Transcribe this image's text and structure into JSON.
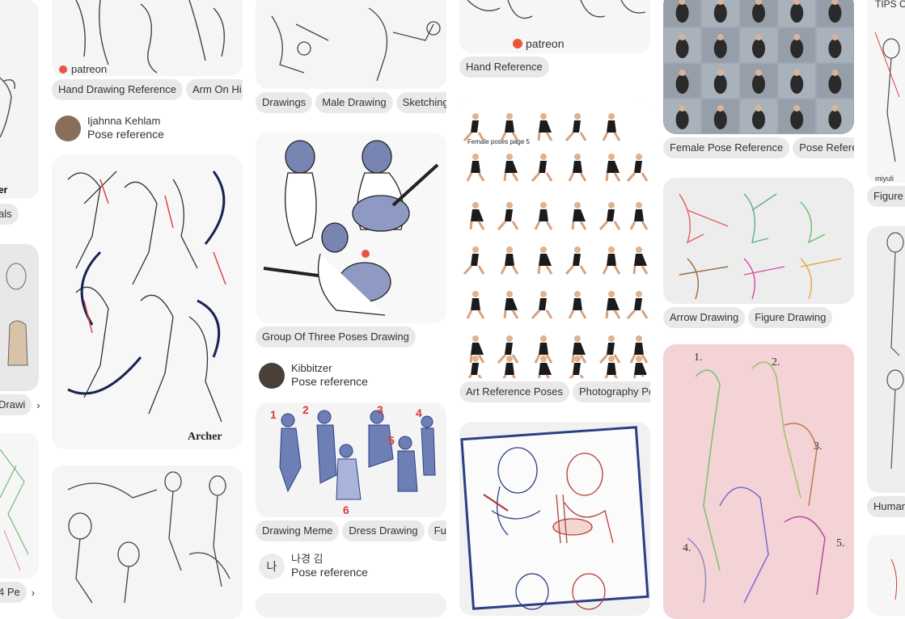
{
  "col0": {
    "chip_a": "als",
    "chip_b": "Drawi",
    "chip_c": "4 Pe",
    "partial_text": "er"
  },
  "col1": {
    "card1_chips": [
      "Hand Drawing Reference",
      "Arm On Hi"
    ],
    "card1_author": "Ijahnna Kehlam",
    "card1_board": "Pose reference",
    "card2_caption": "Archer"
  },
  "col2": {
    "card1_chips": [
      "Drawings",
      "Male Drawing",
      "Sketching"
    ],
    "card2_chips": [
      "Group Of Three Poses Drawing"
    ],
    "card2_author": "Kibbitzer",
    "card2_board": "Pose reference",
    "card3_chips": [
      "Drawing Meme",
      "Dress Drawing",
      "Fu"
    ],
    "card3_author": "나경 김",
    "card3_avatar_letter": "나",
    "card3_board": "Pose reference"
  },
  "col3": {
    "card1_chips": [
      "Hand Reference"
    ],
    "card2_inner_text": "Female poses page 5",
    "card2_chips": [
      "Art Reference Poses",
      "Photography Po"
    ]
  },
  "col4": {
    "card1_chips": [
      "Female Pose Reference",
      "Pose Referen"
    ],
    "card2_chips": [
      "Arrow Drawing",
      "Figure Drawing"
    ],
    "card3_numbers": [
      "1.",
      "2.",
      "3.",
      "4.",
      "5."
    ]
  },
  "col5": {
    "card1_text": "TIPS O",
    "card1_sig": "miyuli",
    "chip_a": "Figure D",
    "chip_b": "Human"
  },
  "watermark": "patreon",
  "chevron": "›",
  "colors": {
    "chip_bg": "#e9e9e9",
    "text": "#333333",
    "sketch": "#444444",
    "red": "#d93a3a",
    "blue": "#2b3f86"
  }
}
